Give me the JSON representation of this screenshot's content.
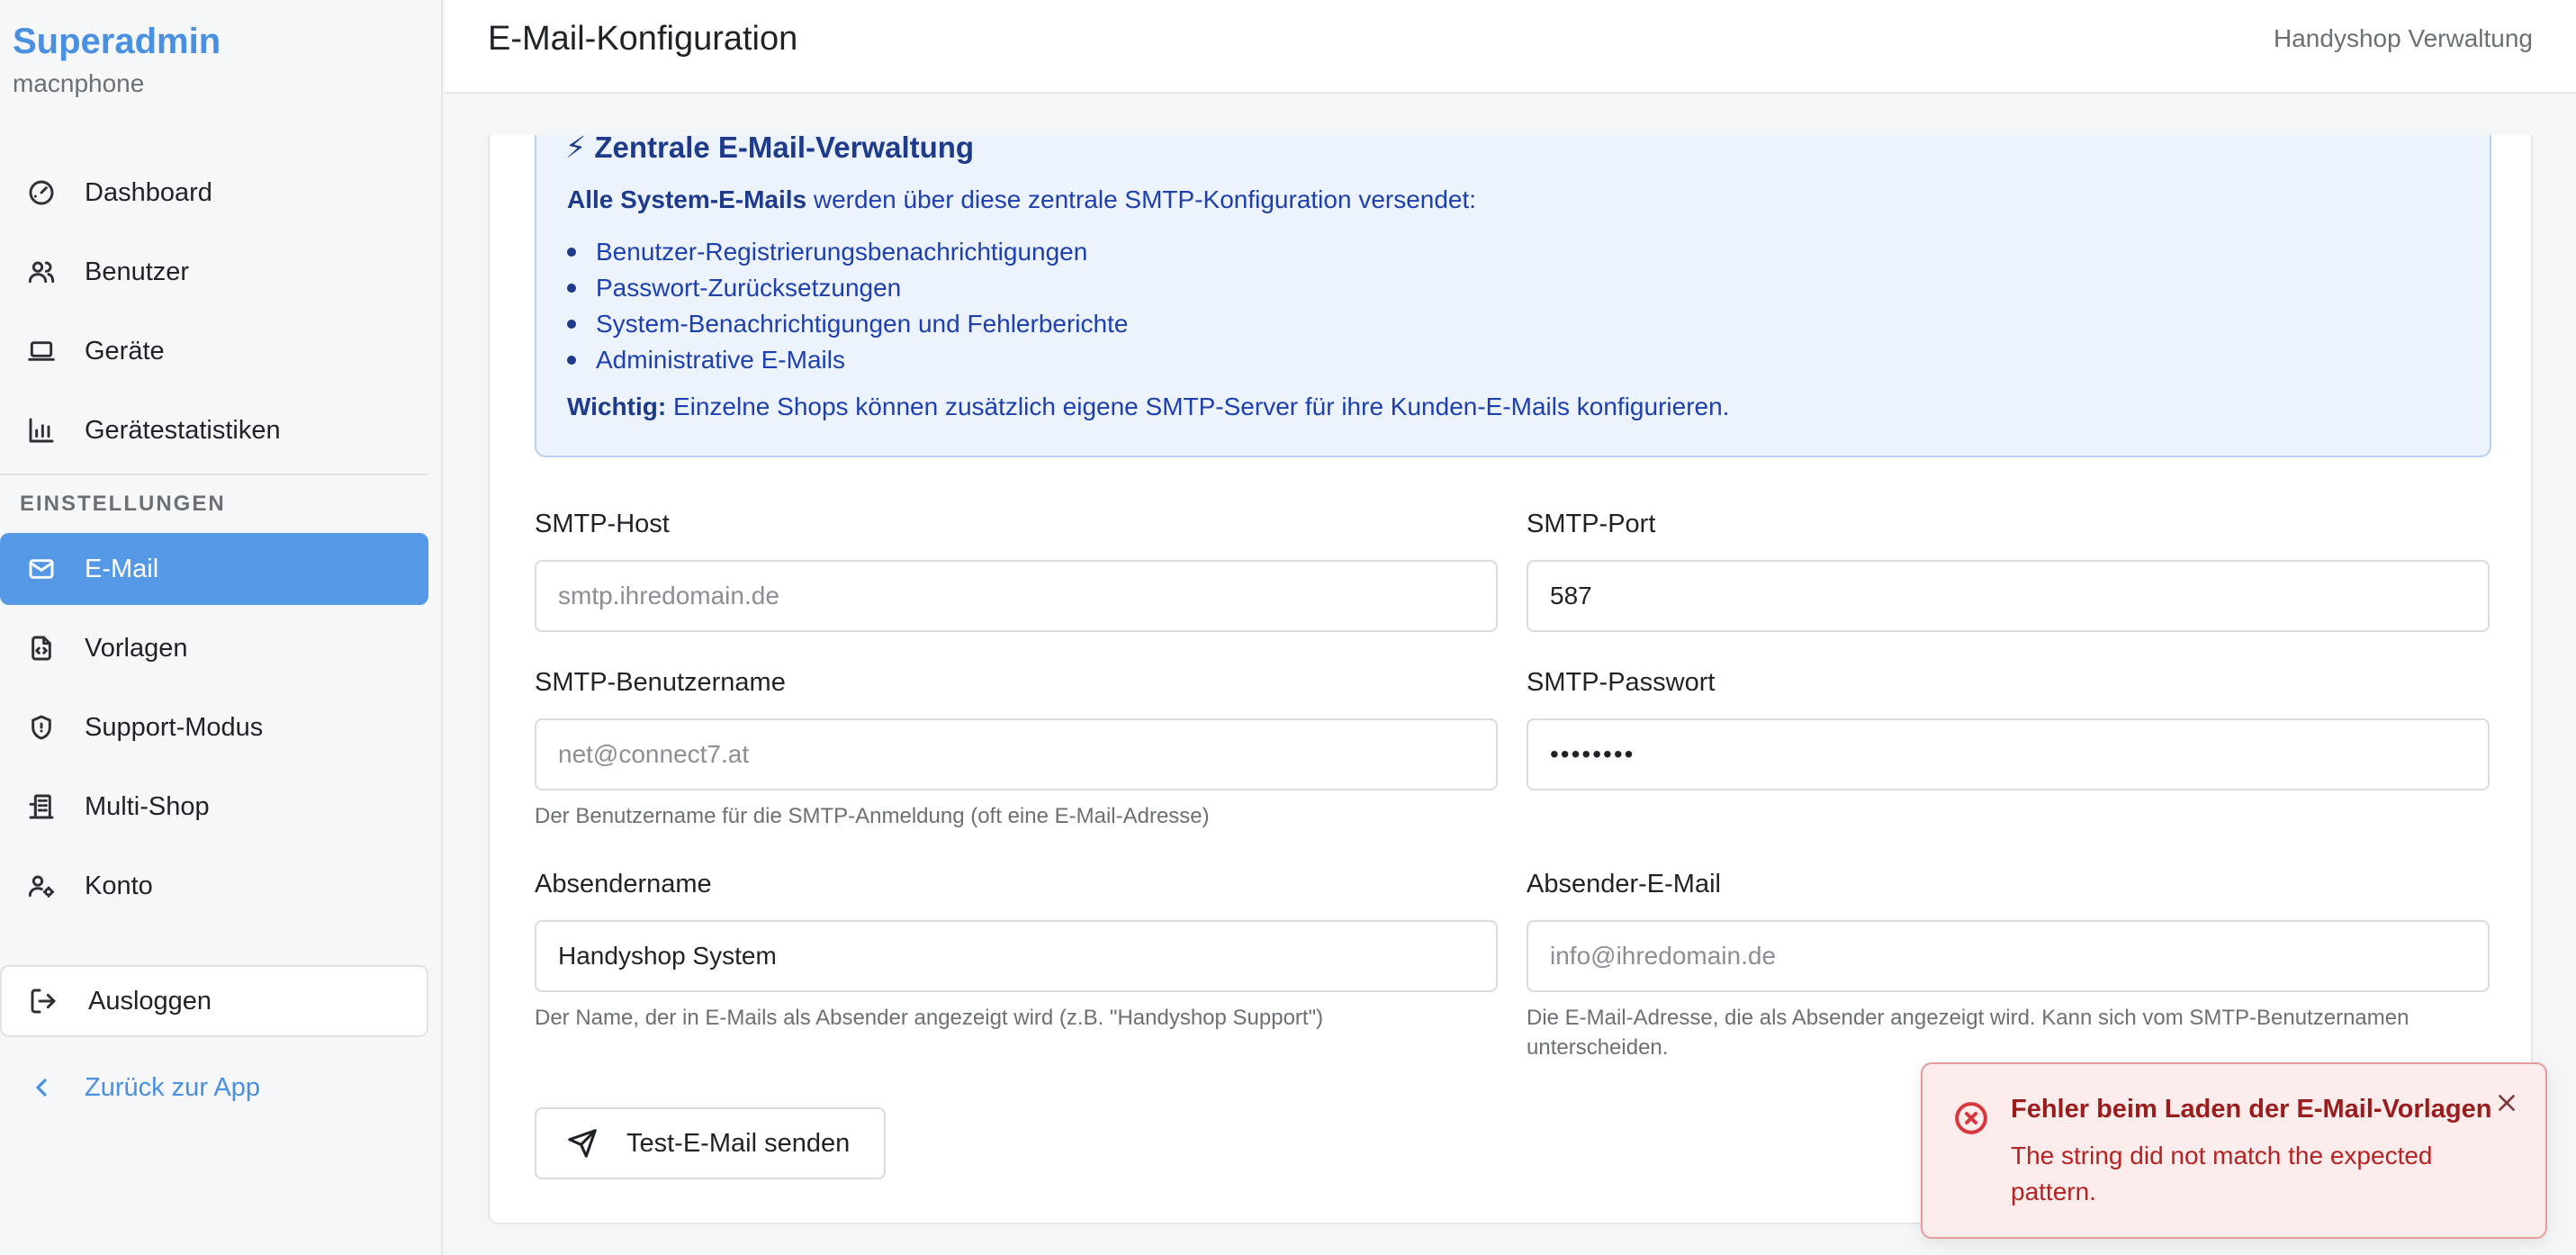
{
  "sidebar": {
    "brand_title": "Superadmin",
    "brand_subtitle": "macnphone",
    "items": [
      {
        "label": "Dashboard",
        "icon": "gauge-icon"
      },
      {
        "label": "Benutzer",
        "icon": "users-icon"
      },
      {
        "label": "Geräte",
        "icon": "laptop-icon"
      },
      {
        "label": "Gerätestatistiken",
        "icon": "bar-chart-icon"
      }
    ],
    "section_label": "EINSTELLUNGEN",
    "settings_items": [
      {
        "label": "E-Mail",
        "icon": "mail-icon",
        "active": true
      },
      {
        "label": "Vorlagen",
        "icon": "file-code-icon"
      },
      {
        "label": "Support-Modus",
        "icon": "shield-icon"
      },
      {
        "label": "Multi-Shop",
        "icon": "building-icon"
      },
      {
        "label": "Konto",
        "icon": "user-settings-icon"
      }
    ],
    "logout_label": "Ausloggen",
    "back_label": "Zurück zur App"
  },
  "header": {
    "title": "E-Mail-Konfiguration",
    "right_text": "Handyshop Verwaltung"
  },
  "info": {
    "title": "⚡ Zentrale E-Mail-Verwaltung",
    "intro_bold": "Alle System-E-Mails",
    "intro_rest": " werden über diese zentrale SMTP-Konfiguration versendet:",
    "list": [
      "Benutzer-Registrierungsbenachrichtigungen",
      "Passwort-Zurücksetzungen",
      "System-Benachrichtigungen und Fehlerberichte",
      "Administrative E-Mails"
    ],
    "note_bold": "Wichtig:",
    "note_rest": " Einzelne Shops können zusätzlich eigene SMTP-Server für ihre Kunden-E-Mails konfigurieren."
  },
  "form": {
    "smtp_host": {
      "label": "SMTP-Host",
      "value": "",
      "placeholder": "smtp.ihredomain.de"
    },
    "smtp_port": {
      "label": "SMTP-Port",
      "value": "587",
      "placeholder": ""
    },
    "smtp_user": {
      "label": "SMTP-Benutzername",
      "value": "",
      "placeholder": "net@connect7.at",
      "hint": "Der Benutzername für die SMTP-Anmeldung (oft eine E-Mail-Adresse)"
    },
    "smtp_password": {
      "label": "SMTP-Passwort",
      "value": "••••••••",
      "placeholder": ""
    },
    "sender_name": {
      "label": "Absendername",
      "value": "Handyshop System",
      "placeholder": "",
      "hint": "Der Name, der in E-Mails als Absender angezeigt wird (z.B. \"Handyshop Support\")"
    },
    "sender_email": {
      "label": "Absender-E-Mail",
      "value": "",
      "placeholder": "info@ihredomain.de",
      "hint": "Die E-Mail-Adresse, die als Absender angezeigt wird. Kann sich vom SMTP-Benutzernamen unterscheiden."
    },
    "test_button": "Test-E-Mail senden"
  },
  "toast": {
    "title": "Fehler beim Laden der E-Mail-Vorlagen",
    "message": "The string did not match the expected pattern.",
    "color": "#d9363e"
  },
  "colors": {
    "accent": "#4a90e2",
    "active_item": "#5598e6",
    "info_bg": "#ecf3fd",
    "info_text": "#1e3a8a",
    "error_bg": "#fdecec"
  }
}
